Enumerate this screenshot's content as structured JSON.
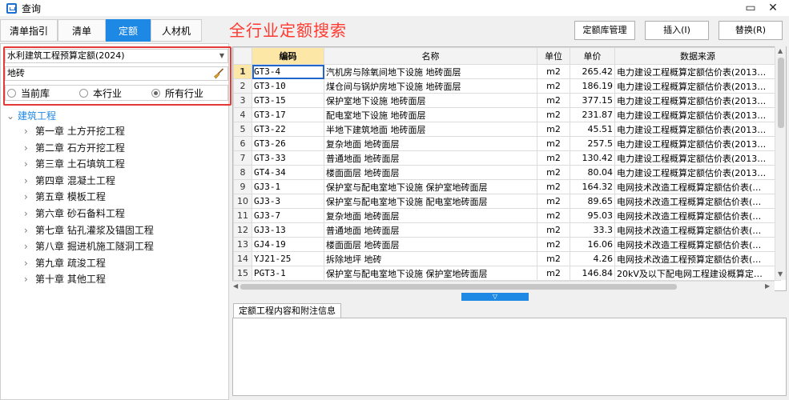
{
  "window": {
    "title": "查询",
    "maximize_glyph": "▭",
    "close_glyph": "✕"
  },
  "tabs": [
    {
      "label": "清单指引",
      "active": false
    },
    {
      "label": "清单",
      "active": false
    },
    {
      "label": "定额",
      "active": true
    },
    {
      "label": "人材机",
      "active": false
    }
  ],
  "headline": "全行业定额搜索",
  "toolbar": {
    "manage_label": "定额库管理",
    "insert_label": "插入(I)",
    "replace_label": "替换(R)"
  },
  "library_select": {
    "value": "水利建筑工程预算定额(2024)"
  },
  "search": {
    "value": "地砖"
  },
  "scope": {
    "options": [
      "当前库",
      "本行业",
      "所有行业"
    ],
    "selected": "所有行业"
  },
  "tree": {
    "root": "建筑工程",
    "chapters": [
      "第一章 土方开挖工程",
      "第二章 石方开挖工程",
      "第三章 土石填筑工程",
      "第四章 混凝土工程",
      "第五章 模板工程",
      "第六章 砂石备料工程",
      "第七章 钻孔灌浆及锚固工程",
      "第八章 掘进机施工隧洞工程",
      "第九章 疏浚工程",
      "第十章 其他工程"
    ]
  },
  "grid": {
    "columns": [
      "编码",
      "名称",
      "单位",
      "单价",
      "数据来源"
    ],
    "rows": [
      {
        "n": "1",
        "code": "GT3-4",
        "name": "汽机房与除氧间地下设施 地砖面层",
        "unit": "m2",
        "price": "265.42",
        "source": "电力建设工程概算定额估价表(2013…"
      },
      {
        "n": "2",
        "code": "GT3-10",
        "name": "煤仓间与锅炉房地下设施 地砖面层",
        "unit": "m2",
        "price": "186.19",
        "source": "电力建设工程概算定额估价表(2013…"
      },
      {
        "n": "3",
        "code": "GT3-15",
        "name": "保护室地下设施 地砖面层",
        "unit": "m2",
        "price": "377.15",
        "source": "电力建设工程概算定额估价表(2013…"
      },
      {
        "n": "4",
        "code": "GT3-17",
        "name": "配电室地下设施 地砖面层",
        "unit": "m2",
        "price": "231.87",
        "source": "电力建设工程概算定额估价表(2013…"
      },
      {
        "n": "5",
        "code": "GT3-22",
        "name": "半地下建筑地面 地砖面层",
        "unit": "m2",
        "price": "45.51",
        "source": "电力建设工程概算定额估价表(2013…"
      },
      {
        "n": "6",
        "code": "GT3-26",
        "name": "复杂地面 地砖面层",
        "unit": "m2",
        "price": "257.5",
        "source": "电力建设工程概算定额估价表(2013…"
      },
      {
        "n": "7",
        "code": "GT3-33",
        "name": "普通地面 地砖面层",
        "unit": "m2",
        "price": "130.42",
        "source": "电力建设工程概算定额估价表(2013…"
      },
      {
        "n": "8",
        "code": "GT4-34",
        "name": "楼面面层 地砖面层",
        "unit": "m2",
        "price": "80.04",
        "source": "电力建设工程概算定额估价表(2013…"
      },
      {
        "n": "9",
        "code": "GJ3-1",
        "name": "保护室与配电室地下设施 保护室地砖面层",
        "unit": "m2",
        "price": "164.32",
        "source": "电网技术改造工程概算定额估价表(…"
      },
      {
        "n": "10",
        "code": "GJ3-3",
        "name": "保护室与配电室地下设施 配电室地砖面层",
        "unit": "m2",
        "price": "89.65",
        "source": "电网技术改造工程概算定额估价表(…"
      },
      {
        "n": "11",
        "code": "GJ3-7",
        "name": "复杂地面 地砖面层",
        "unit": "m2",
        "price": "95.03",
        "source": "电网技术改造工程概算定额估价表(…"
      },
      {
        "n": "12",
        "code": "GJ3-13",
        "name": "普通地面 地砖面层",
        "unit": "m2",
        "price": "33.3",
        "source": "电网技术改造工程概算定额估价表(…"
      },
      {
        "n": "13",
        "code": "GJ4-19",
        "name": "楼面面层 地砖面层",
        "unit": "m2",
        "price": "16.06",
        "source": "电网技术改造工程概算定额估价表(…"
      },
      {
        "n": "14",
        "code": "YJ21-25",
        "name": "拆除地坪 地砖",
        "unit": "m2",
        "price": "4.26",
        "source": "电网技术改造工程预算定额估价表(…"
      },
      {
        "n": "15",
        "code": "PGT3-1",
        "name": "保护室与配电室地下设施 保护室地砖面层",
        "unit": "m2",
        "price": "146.84",
        "source": "20kV及以下配电网工程建设概算定…"
      }
    ]
  },
  "info_tab": {
    "label": "定额工程内容和附注信息"
  },
  "colors": {
    "accent": "#1e88e5",
    "headline": "#ff3a30",
    "highlight_border": "#e53935",
    "header_cell": "#fce7a6"
  }
}
